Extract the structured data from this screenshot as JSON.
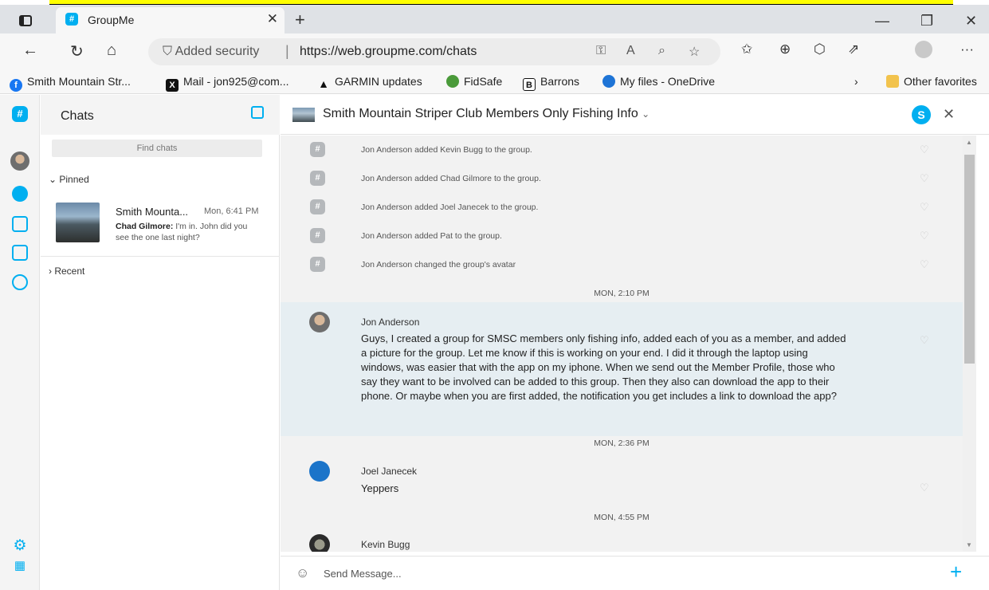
{
  "browser": {
    "tab_title": "GroupMe",
    "security_label": "Added security",
    "url": "https://web.groupme.com/chats",
    "favorites": [
      {
        "label": "Smith Mountain Str..."
      },
      {
        "label": "Mail - jon925@com..."
      },
      {
        "label": "GARMIN updates"
      },
      {
        "label": "FidSafe"
      },
      {
        "label": "Barrons"
      },
      {
        "label": "My files - OneDrive"
      },
      {
        "label": "Other favorites"
      }
    ]
  },
  "sidebar": {
    "title": "Chats",
    "find_placeholder": "Find chats",
    "pinned_label": "Pinned",
    "recent_label": "Recent",
    "pinned_chat": {
      "name": "Smith Mounta...",
      "time": "Mon, 6:41 PM",
      "preview_author": "Chad Gilmore:",
      "preview_text": " I'm in. John did you see the one last night?"
    }
  },
  "chat": {
    "group_name": "Smith Mountain Striper Club Members Only Fishing Info",
    "system_messages": [
      "Jon Anderson added Kevin Bugg to the group.",
      "Jon Anderson added Chad Gilmore to the group.",
      "Jon Anderson added Joel Janecek to the group.",
      "Jon Anderson added Pat to the group.",
      "Jon Anderson changed the group's avatar"
    ],
    "dividers": [
      "MON, 2:10 PM",
      "MON, 2:36 PM",
      "MON, 4:55 PM"
    ],
    "messages": [
      {
        "author": "Jon Anderson",
        "text": "Guys, I created a group for SMSC members only fishing info, added each of you as a member, and added a picture for the group. Let me know if this is working on your end. I did it through the laptop using windows, was easier that with the app on my iphone. When we send out the Member Profile, those who say they want to be involved can be added to this group. Then they also can download the app to their phone. Or maybe when you are first added, the notification you get includes a link to download the app?"
      },
      {
        "author": "Joel Janecek",
        "text": "Yeppers"
      },
      {
        "author": "Kevin Bugg",
        "text": ""
      }
    ],
    "compose_placeholder": "Send Message..."
  },
  "colors": {
    "accent": "#00aff0",
    "highlight": "#e6eef2"
  }
}
